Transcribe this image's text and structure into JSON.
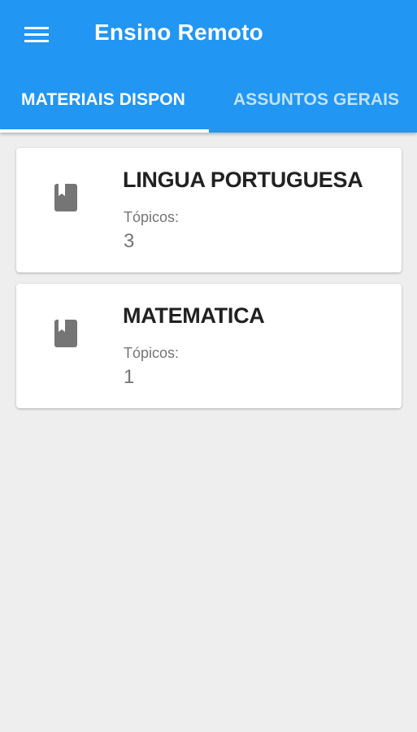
{
  "app": {
    "title": "Ensino Remoto",
    "menu_icon": "menu-icon",
    "primary_color": "#2196f3"
  },
  "tabs": [
    {
      "label": "MATERIAIS DISPONÍVEIS",
      "selected": true
    },
    {
      "label": "ASSUNTOS GERAIS",
      "selected": false
    }
  ],
  "subjects": [
    {
      "icon": "book-icon",
      "name": "LINGUA PORTUGUESA",
      "topics_label": "Tópicos:",
      "topics_count": "3"
    },
    {
      "icon": "book-icon",
      "name": "MATEMATICA",
      "topics_label": "Tópicos:",
      "topics_count": "1"
    }
  ]
}
